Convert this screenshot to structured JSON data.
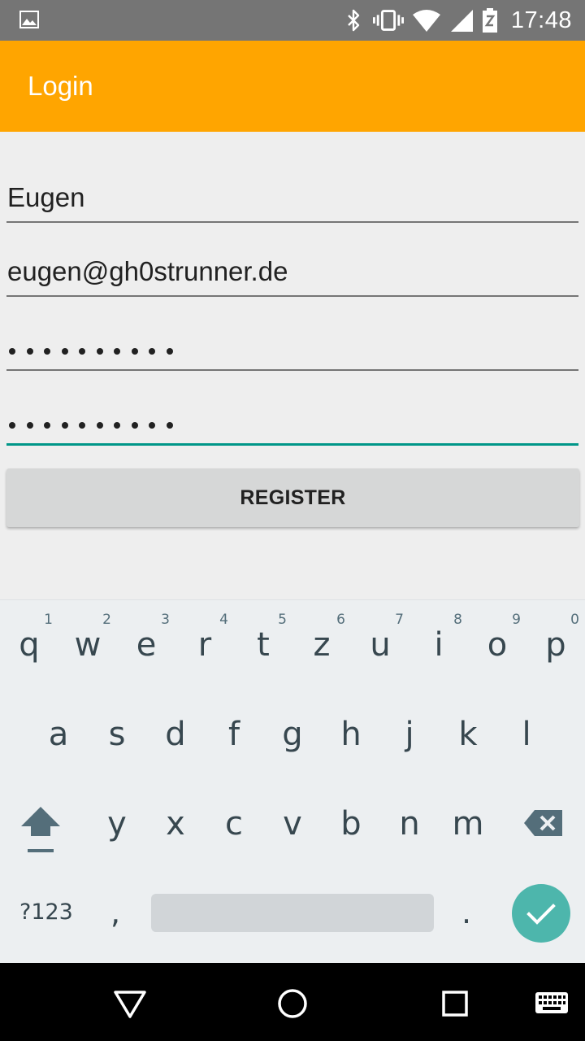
{
  "status_bar": {
    "time": "17:48",
    "icons": [
      "image-icon",
      "bluetooth-icon",
      "vibrate-icon",
      "wifi-icon",
      "signal-icon",
      "battery-icon"
    ]
  },
  "app_bar": {
    "title": "Login",
    "color": "#ffa500"
  },
  "form": {
    "name_value": "Eugen",
    "email_value": "eugen@gh0strunner.de",
    "password_dots": 10,
    "confirm_dots": 10,
    "register_label": "REGISTER",
    "focus_color": "#009688"
  },
  "keyboard": {
    "row1": [
      {
        "ch": "q",
        "hint": "1"
      },
      {
        "ch": "w",
        "hint": "2"
      },
      {
        "ch": "e",
        "hint": "3"
      },
      {
        "ch": "r",
        "hint": "4"
      },
      {
        "ch": "t",
        "hint": "5"
      },
      {
        "ch": "z",
        "hint": "6"
      },
      {
        "ch": "u",
        "hint": "7"
      },
      {
        "ch": "i",
        "hint": "8"
      },
      {
        "ch": "o",
        "hint": "9"
      },
      {
        "ch": "p",
        "hint": "0"
      }
    ],
    "row2": [
      "a",
      "s",
      "d",
      "f",
      "g",
      "h",
      "j",
      "k",
      "l"
    ],
    "row3": [
      "y",
      "x",
      "c",
      "v",
      "b",
      "n",
      "m"
    ],
    "symbols_label": "?123",
    "comma": ",",
    "period": ".",
    "enter_color": "#4db6ac"
  },
  "nav_bar": {
    "icons": [
      "back-icon",
      "home-icon",
      "recents-icon",
      "keyboard-switch-icon"
    ]
  }
}
